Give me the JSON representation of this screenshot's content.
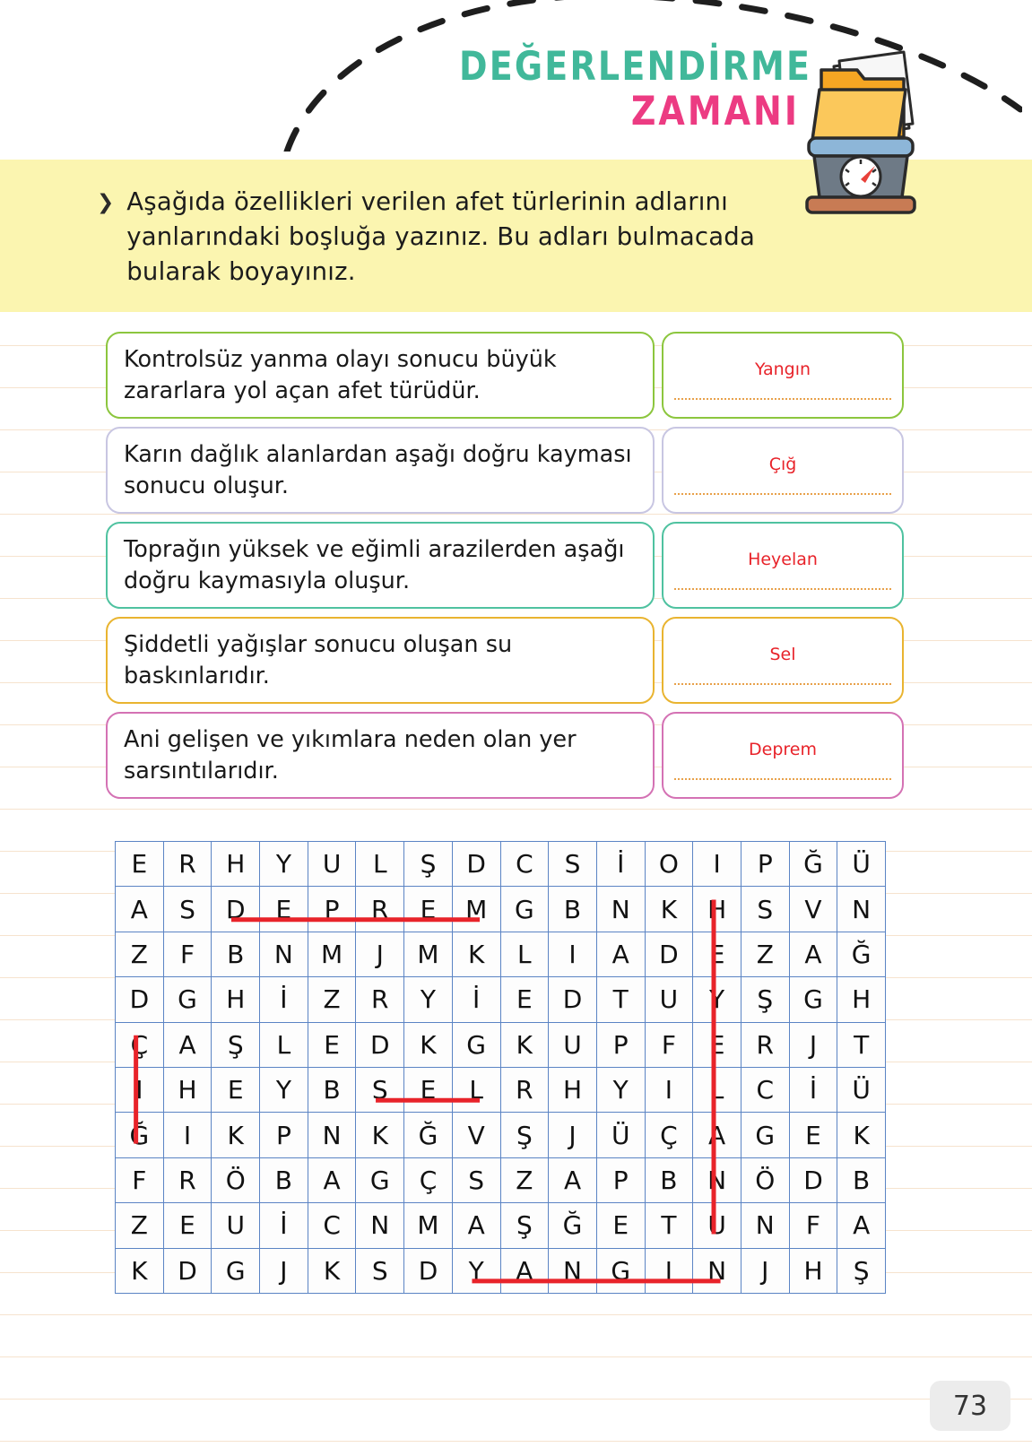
{
  "header": {
    "title_line1": "DEĞERLENDİRME",
    "title_line2": "ZAMANI",
    "title_color_1": "#41b89a",
    "title_color_2": "#ec3b82",
    "illustration": "scale-with-folder-icon"
  },
  "instruction": {
    "bullet": "❯",
    "text": "Aşağıda özellikleri verilen afet türlerinin adlarını yanlarındaki boşluğa yazınız. Bu adları bulmacada bularak boyayınız.",
    "background_color": "#fbf5b0"
  },
  "cards": [
    {
      "description": "Kontrolsüz yanma olayı sonucu büyük zararlara yol açan afet türüdür.",
      "answer": "Yangın",
      "border_color": "#8cc63e"
    },
    {
      "description": "Karın dağlık alanlardan aşağı doğru kayması sonucu oluşur.",
      "answer": "Çığ",
      "border_color": "#c8c6e2"
    },
    {
      "description": "Toprağın yüksek ve eğimli arazilerden aşağı doğru kaymasıyla oluşur.",
      "answer": "Heyelan",
      "border_color": "#4fc2a0"
    },
    {
      "description": "Şiddetli yağışlar sonucu oluşan su baskınlarıdır.",
      "answer": "Sel",
      "border_color": "#e9b430"
    },
    {
      "description": "Ani gelişen ve yıkımlara neden olan yer sarsıntılarıdır.",
      "answer": "Deprem",
      "border_color": "#d472b4"
    }
  ],
  "answer_text_color": "#e8232a",
  "word_search": {
    "rows": 10,
    "cols": 16,
    "grid": [
      [
        "E",
        "R",
        "H",
        "Y",
        "U",
        "L",
        "Ş",
        "D",
        "C",
        "S",
        "İ",
        "O",
        "I",
        "P",
        "Ğ",
        "Ü"
      ],
      [
        "A",
        "S",
        "D",
        "E",
        "P",
        "R",
        "E",
        "M",
        "G",
        "B",
        "N",
        "K",
        "H",
        "S",
        "V",
        "N"
      ],
      [
        "Z",
        "F",
        "B",
        "N",
        "M",
        "J",
        "M",
        "K",
        "L",
        "I",
        "A",
        "D",
        "E",
        "Z",
        "A",
        "Ğ"
      ],
      [
        "D",
        "G",
        "H",
        "İ",
        "Z",
        "R",
        "Y",
        "İ",
        "E",
        "D",
        "T",
        "U",
        "Y",
        "Ş",
        "G",
        "H"
      ],
      [
        "Ç",
        "A",
        "Ş",
        "L",
        "E",
        "D",
        "K",
        "G",
        "K",
        "U",
        "P",
        "F",
        "E",
        "R",
        "J",
        "T"
      ],
      [
        "I",
        "H",
        "E",
        "Y",
        "B",
        "S",
        "E",
        "L",
        "R",
        "H",
        "Y",
        "I",
        "L",
        "C",
        "İ",
        "Ü"
      ],
      [
        "Ğ",
        "I",
        "K",
        "P",
        "N",
        "K",
        "Ğ",
        "V",
        "Ş",
        "J",
        "Ü",
        "Ç",
        "A",
        "G",
        "E",
        "K"
      ],
      [
        "F",
        "R",
        "Ö",
        "B",
        "A",
        "G",
        "Ç",
        "S",
        "Z",
        "A",
        "P",
        "B",
        "N",
        "Ö",
        "D",
        "B"
      ],
      [
        "Z",
        "E",
        "U",
        "İ",
        "C",
        "N",
        "M",
        "A",
        "Ş",
        "Ğ",
        "E",
        "T",
        "U",
        "N",
        "F",
        "A"
      ],
      [
        "K",
        "D",
        "G",
        "J",
        "K",
        "S",
        "D",
        "Y",
        "A",
        "N",
        "G",
        "I",
        "N",
        "J",
        "H",
        "Ş"
      ]
    ],
    "marks": [
      {
        "word": "DEPREM",
        "orientation": "horizontal",
        "row": 1,
        "col_start": 2,
        "col_end": 7
      },
      {
        "word": "HEYELAN",
        "orientation": "vertical",
        "col": 12,
        "row_start": 1,
        "row_end": 8
      },
      {
        "word": "ÇIĞ",
        "orientation": "vertical",
        "col": 0,
        "row_start": 4,
        "row_end": 6
      },
      {
        "word": "SEL",
        "orientation": "horizontal",
        "row": 5,
        "col_start": 5,
        "col_end": 7
      },
      {
        "word": "YANGIN",
        "orientation": "horizontal",
        "row": 9,
        "col_start": 7,
        "col_end": 12
      }
    ],
    "mark_color": "#e8232a",
    "cell_border_color": "#5b84c4"
  },
  "page_number": "73"
}
